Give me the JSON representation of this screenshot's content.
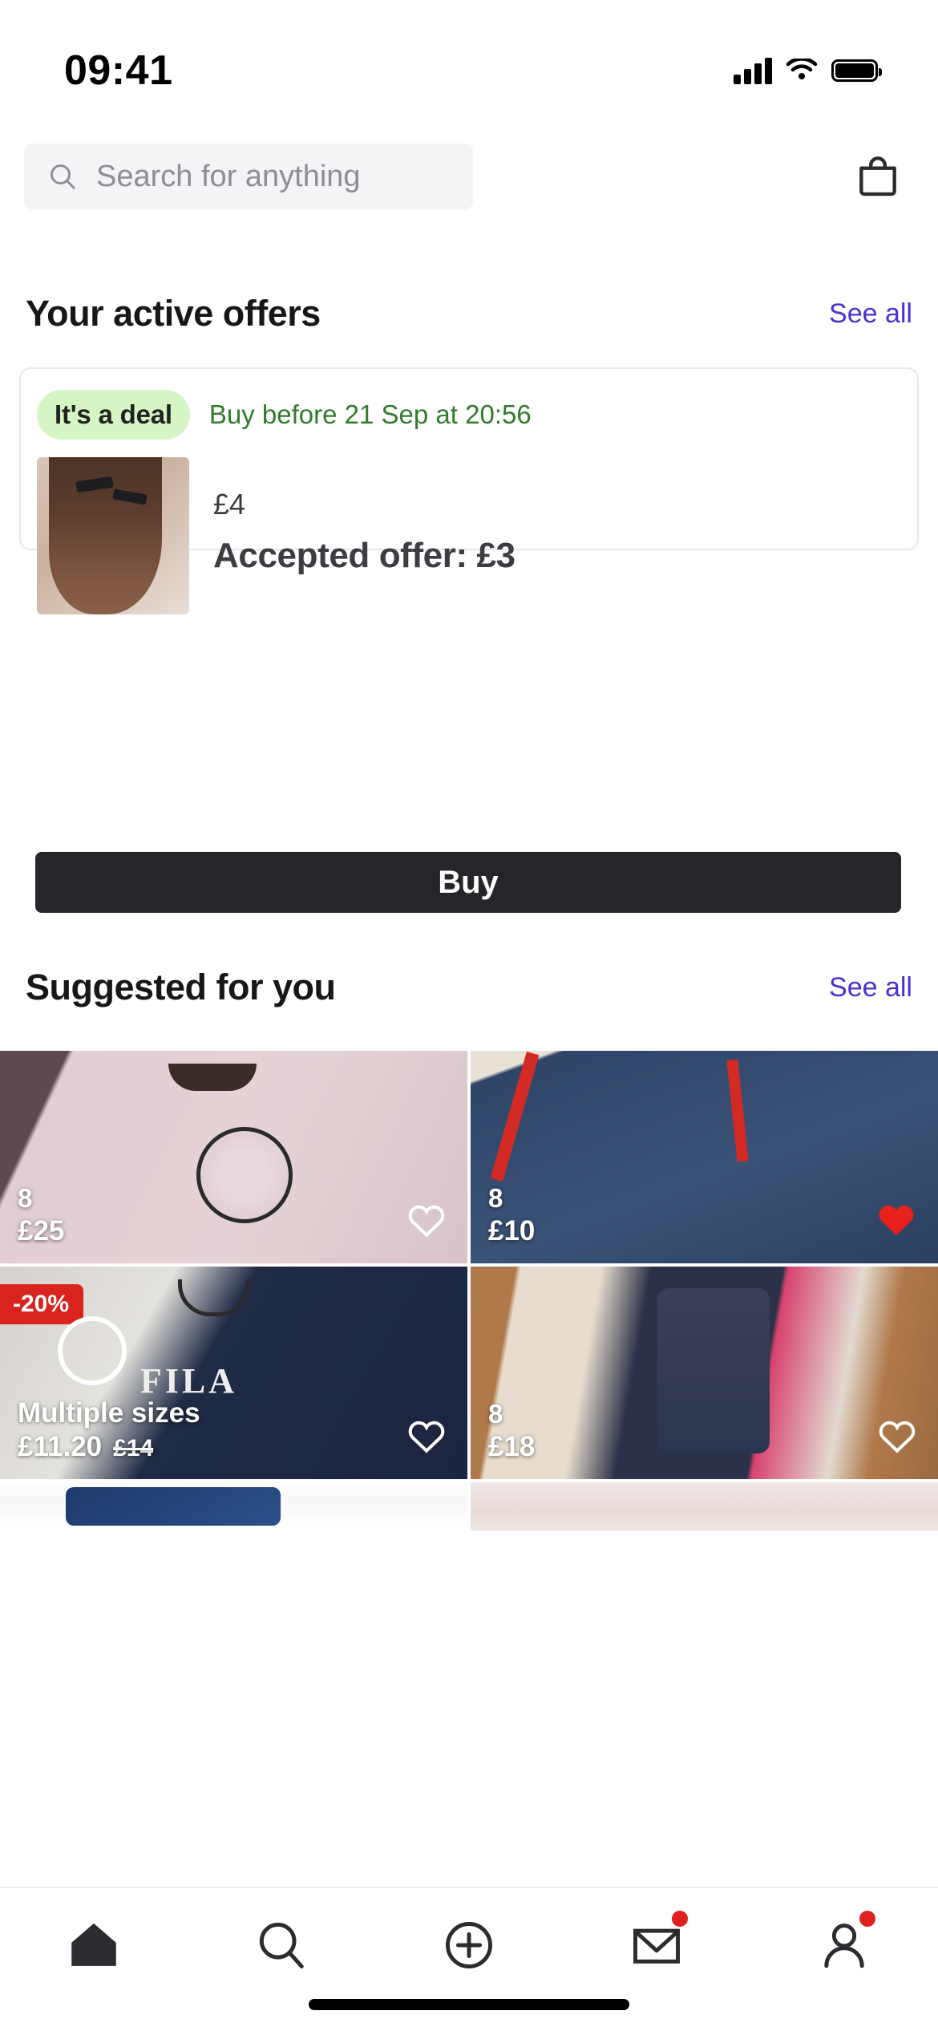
{
  "status_bar": {
    "time": "09:41",
    "signal_icon": "cellular-bars-icon",
    "wifi_icon": "wifi-icon",
    "battery_icon": "battery-full-icon"
  },
  "header": {
    "search": {
      "placeholder": "Search for anything",
      "value": "",
      "icon": "search-icon"
    },
    "bag_icon": "shopping-bag-icon"
  },
  "active_offers": {
    "title": "Your active offers",
    "see_all": "See all",
    "card": {
      "badge": "It's a deal",
      "deadline": "Buy before 21 Sep at 20:56",
      "thumbnail_alt": "hair-bows-photo",
      "list_price": "£4",
      "accepted_offer": "Accepted offer: £3",
      "buy_label": "Buy"
    }
  },
  "suggested": {
    "title": "Suggested for you",
    "see_all": "See all",
    "items": [
      {
        "image_alt": "pink-stone-island-tshirt",
        "size": "8",
        "price": "£25",
        "old_price": "",
        "discount": "",
        "multiple_sizes": "",
        "favourite": false,
        "heart_icon": "heart-outline-icon"
      },
      {
        "image_alt": "blue-reebok-tracksuit",
        "size": "8",
        "price": "£10",
        "old_price": "",
        "discount": "",
        "multiple_sizes": "",
        "favourite": true,
        "heart_icon": "heart-filled-icon"
      },
      {
        "image_alt": "navy-fila-sweatshirt",
        "size": "",
        "price": "£11.20",
        "old_price": "£14",
        "discount": "-20%",
        "multiple_sizes": "Multiple sizes",
        "favourite": false,
        "heart_icon": "heart-outline-icon"
      },
      {
        "image_alt": "navy-air-jordan-sweatshirt-mirror-selfie",
        "size": "8",
        "price": "£18",
        "old_price": "",
        "discount": "",
        "multiple_sizes": "",
        "favourite": false,
        "heart_icon": "heart-outline-icon"
      },
      {
        "image_alt": "blue-jeans-partial",
        "size": "",
        "price": "",
        "old_price": "",
        "discount": "",
        "multiple_sizes": "",
        "favourite": false,
        "heart_icon": "heart-outline-icon"
      },
      {
        "image_alt": "light-pink-item-partial",
        "size": "",
        "price": "",
        "old_price": "",
        "discount": "",
        "multiple_sizes": "",
        "favourite": false,
        "heart_icon": "heart-outline-icon"
      }
    ]
  },
  "bottom_nav": {
    "items": [
      {
        "name": "home",
        "icon": "home-icon",
        "active": true,
        "badge": false
      },
      {
        "name": "search",
        "icon": "search-icon",
        "active": false,
        "badge": false
      },
      {
        "name": "sell",
        "icon": "plus-circle-icon",
        "active": false,
        "badge": false
      },
      {
        "name": "inbox",
        "icon": "envelope-icon",
        "active": false,
        "badge": true
      },
      {
        "name": "profile",
        "icon": "person-icon",
        "active": false,
        "badge": true
      }
    ]
  },
  "colors": {
    "accent_link": "#4a31d4",
    "deal_badge_bg": "#d6f5c4",
    "deal_text": "#317b2b",
    "discount_badge": "#d9241e",
    "buy_button": "#26262a",
    "favourite_heart": "#e01f1f"
  }
}
